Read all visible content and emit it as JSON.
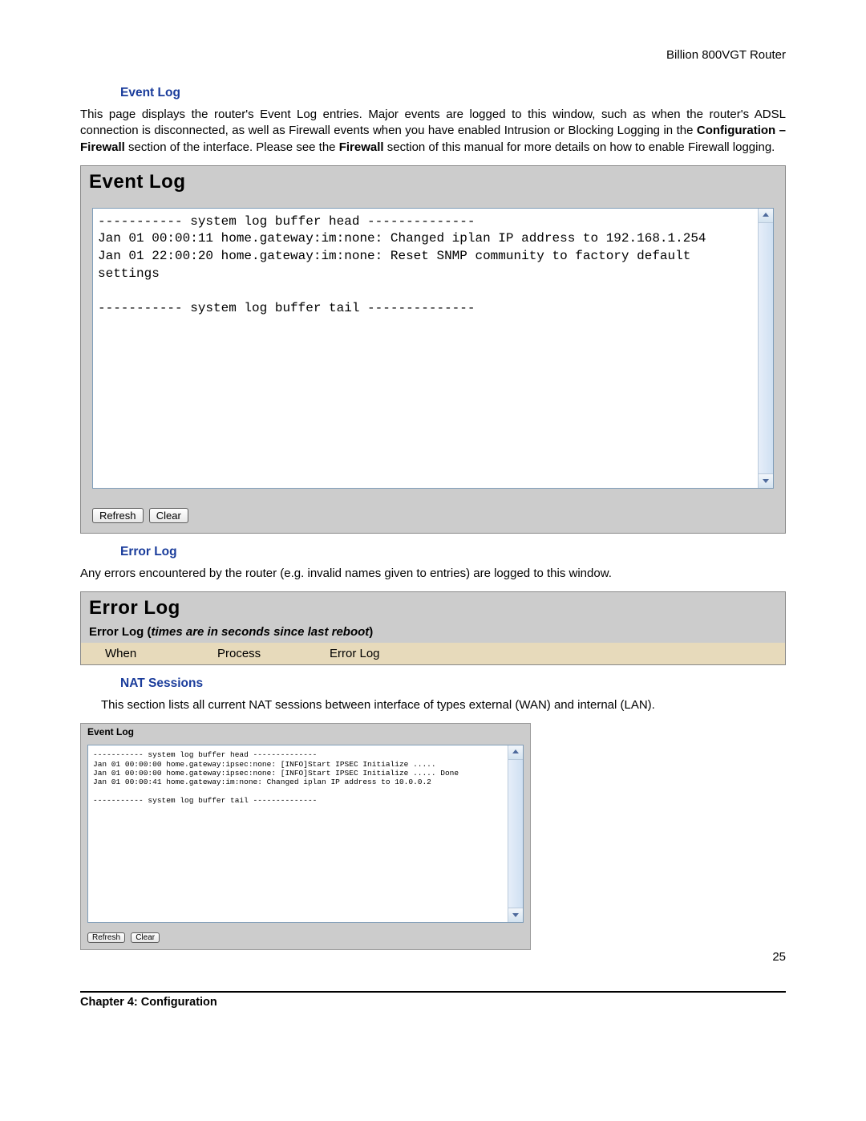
{
  "header": {
    "product": "Billion 800VGT Router"
  },
  "sections": {
    "event_log": {
      "heading": "Event Log",
      "intro_pre": "This page displays the router's Event Log entries. Major events are logged to this window, such as when the router's ADSL connection is disconnected, as well as Firewall events when you have enabled Intrusion or Blocking Logging in the ",
      "intro_bold": "Configuration – Firewall",
      "intro_mid": " section of the interface. Please see the ",
      "intro_bold2": "Firewall",
      "intro_post": " section of this manual for more details on how to enable Firewall logging."
    },
    "error_log": {
      "heading": "Error Log",
      "intro": "Any errors encountered by the router (e.g. invalid names given to entries) are logged to this window."
    },
    "nat_sessions": {
      "heading": "NAT Sessions",
      "intro": "This section lists all current NAT sessions between interface of types external (WAN) and internal (LAN)."
    }
  },
  "panel1": {
    "title": "Event Log",
    "log_text": "----------- system log buffer head --------------\nJan 01 00:00:11 home.gateway:im:none: Changed iplan IP address to 192.168.1.254\nJan 01 22:00:20 home.gateway:im:none: Reset SNMP community to factory default\nsettings\n\n----------- system log buffer tail --------------",
    "btn_refresh": "Refresh",
    "btn_clear": "Clear"
  },
  "panel_err": {
    "title": "Error Log",
    "sub_pre": "Error Log (",
    "sub_italic": "times are in seconds since last reboot",
    "sub_post": ")",
    "col_when": "When",
    "col_process": "Process",
    "col_errorlog": "Error Log"
  },
  "panel2": {
    "title": "Event Log",
    "log_text": "----------- system log buffer head --------------\nJan 01 00:00:00 home.gateway:ipsec:none: [INFO]Start IPSEC Initialize .....\nJan 01 00:00:00 home.gateway:ipsec:none: [INFO]Start IPSEC Initialize ..... Done\nJan 01 00:00:41 home.gateway:im:none: Changed iplan IP address to 10.0.0.2\n\n----------- system log buffer tail --------------",
    "btn_refresh": "Refresh",
    "btn_clear": "Clear"
  },
  "footer": {
    "page": "25",
    "chapter": "Chapter 4: Configuration"
  }
}
